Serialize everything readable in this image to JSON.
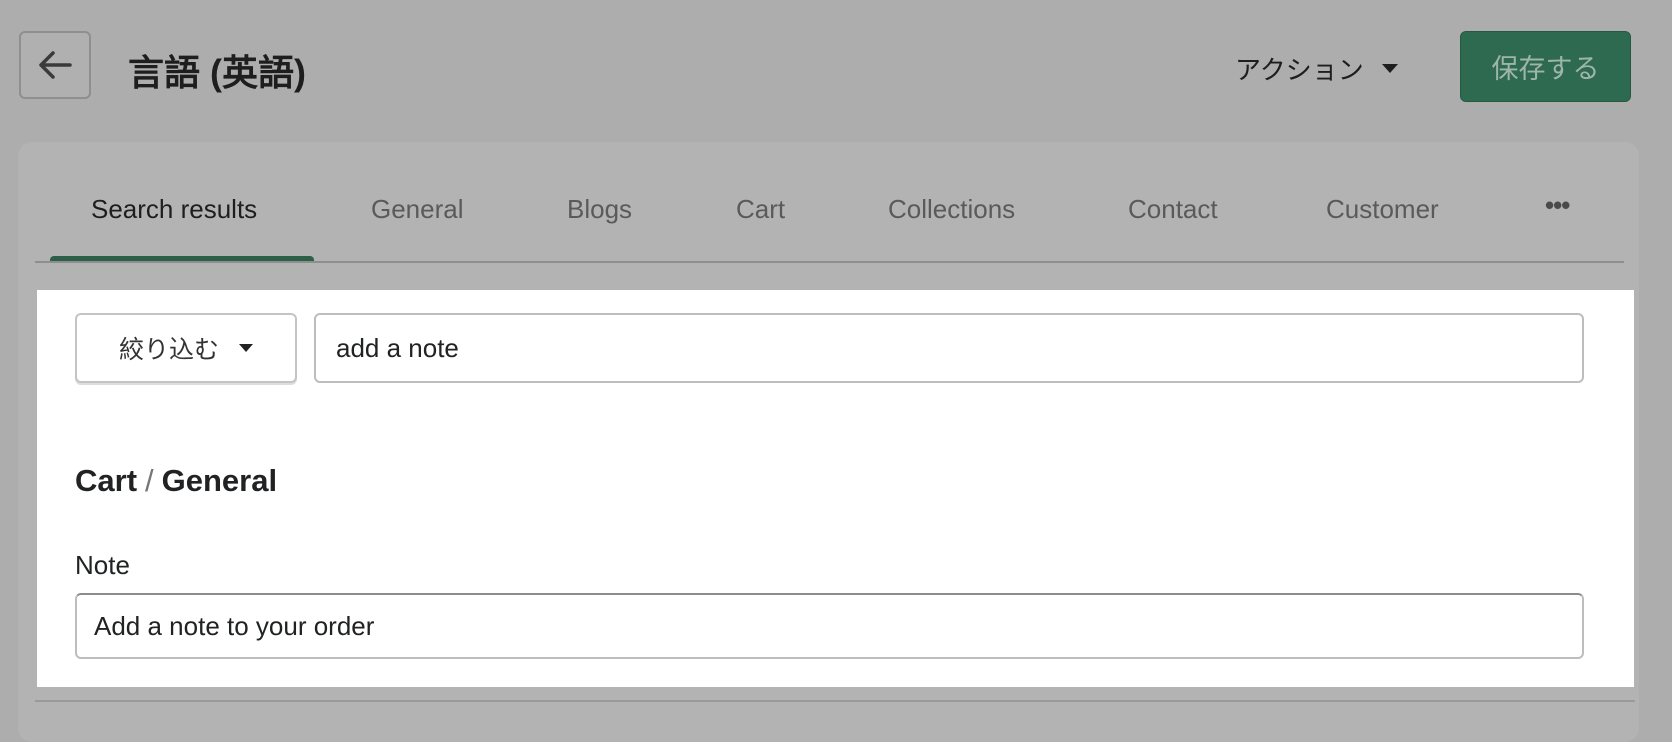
{
  "header": {
    "back_icon": "arrow-left-icon",
    "title": "言語 (英語)",
    "actions_label": "アクション",
    "save_label": "保存する",
    "accent_color": "#2d6a4f"
  },
  "tabs": [
    {
      "label": "Search results",
      "active": true
    },
    {
      "label": "General"
    },
    {
      "label": "Blogs"
    },
    {
      "label": "Cart"
    },
    {
      "label": "Collections"
    },
    {
      "label": "Contact"
    },
    {
      "label": "Customer"
    }
  ],
  "more_tabs_icon": "ellipsis-icon",
  "filter": {
    "label": "絞り込む"
  },
  "search": {
    "value": "add a note"
  },
  "section": {
    "part1": "Cart",
    "separator": "/",
    "part2": "General"
  },
  "field": {
    "label": "Note",
    "value": "Add a note to your order"
  }
}
